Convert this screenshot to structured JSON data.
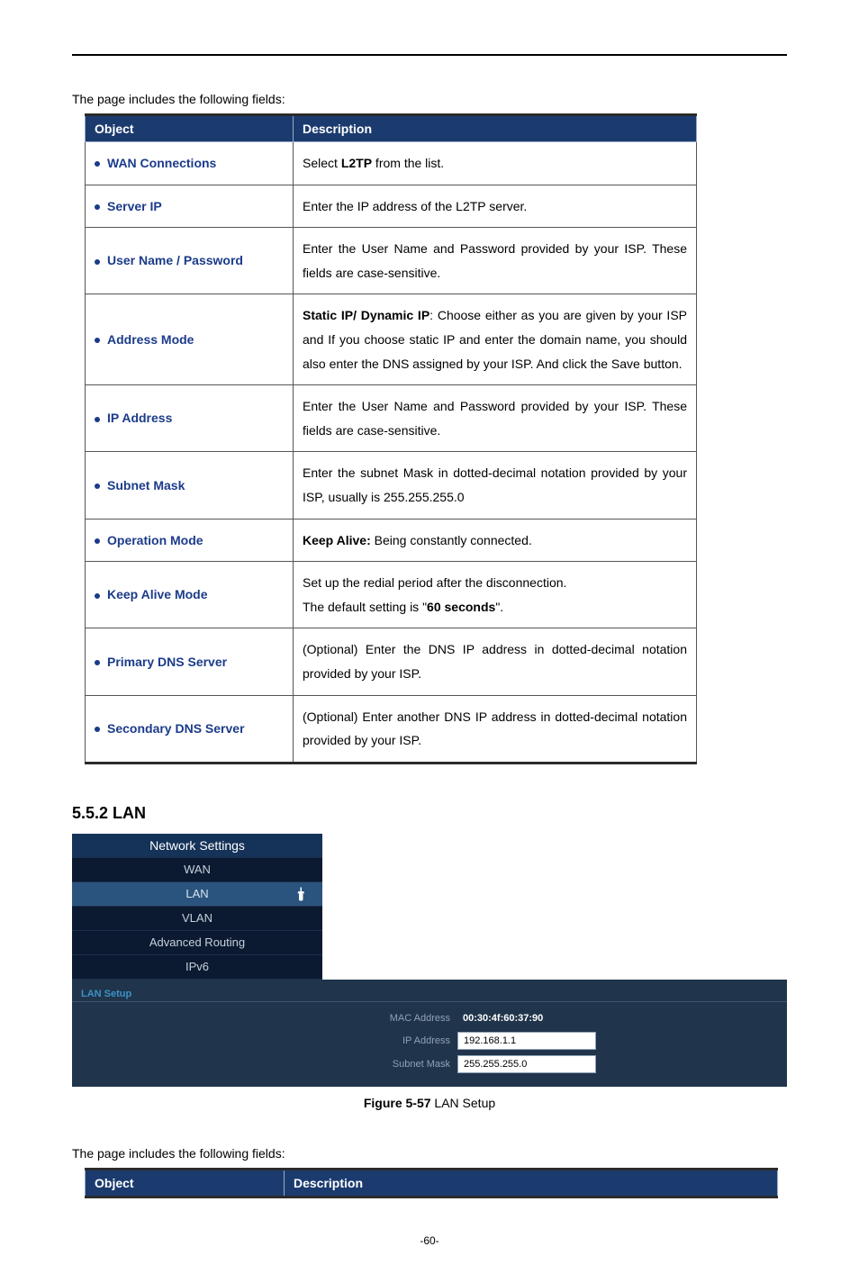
{
  "intro1": "The page includes the following fields:",
  "intro2": "The page includes the following fields:",
  "th_object": "Object",
  "th_desc": "Description",
  "rows": [
    {
      "obj": "WAN Connections",
      "desc_pre": "Select ",
      "desc_bold": "L2TP",
      "desc_post": " from the list."
    },
    {
      "obj": "Server IP",
      "desc_pre": "Enter the IP address of the L2TP server.",
      "desc_bold": "",
      "desc_post": ""
    },
    {
      "obj": "User Name / Password",
      "desc_pre": "Enter the User Name and Password provided by your ISP. These fields are case-sensitive.",
      "desc_bold": "",
      "desc_post": ""
    },
    {
      "obj": "Address Mode",
      "desc_pre": "",
      "desc_bold": "Static IP/ Dynamic IP",
      "desc_post": ": Choose either as you are given by your ISP and If you choose static IP and enter the domain name, you should also enter the DNS assigned by your ISP. And click the Save button."
    },
    {
      "obj": "IP Address",
      "desc_pre": "Enter the User Name and Password provided by your ISP. These fields are case-sensitive.",
      "desc_bold": "",
      "desc_post": ""
    },
    {
      "obj": "Subnet Mask",
      "desc_pre": "Enter the subnet Mask in dotted-decimal notation provided by your ISP, usually is 255.255.255.0",
      "desc_bold": "",
      "desc_post": ""
    },
    {
      "obj": "Operation Mode",
      "desc_pre": "",
      "desc_bold": "Keep Alive:",
      "desc_post": " Being constantly connected."
    },
    {
      "obj": "Keep Alive Mode",
      "desc_pre": "Set up the redial period after the disconnection.\nThe default setting is \"",
      "desc_bold": "60 seconds",
      "desc_post": "\"."
    },
    {
      "obj": "Primary DNS Server",
      "desc_pre": "(Optional) Enter the DNS IP address in dotted-decimal notation provided by your ISP.",
      "desc_bold": "",
      "desc_post": ""
    },
    {
      "obj": "Secondary DNS Server",
      "desc_pre": "(Optional) Enter another DNS IP address in dotted-decimal notation provided by your ISP.",
      "desc_bold": "",
      "desc_post": ""
    }
  ],
  "section": "5.5.2  LAN",
  "nav": {
    "title": "Network Settings",
    "items": [
      "WAN",
      "LAN",
      "VLAN",
      "Advanced Routing",
      "IPv6"
    ]
  },
  "lan": {
    "title": "LAN Setup",
    "mac_label": "MAC Address",
    "mac": "00:30:4f:60:37:90",
    "ip_label": "IP Address",
    "ip": "192.168.1.1",
    "mask_label": "Subnet Mask",
    "mask": "255.255.255.0"
  },
  "figcap_bold": "Figure 5-57",
  "figcap_rest": " LAN Setup",
  "pagenum": "-60-"
}
